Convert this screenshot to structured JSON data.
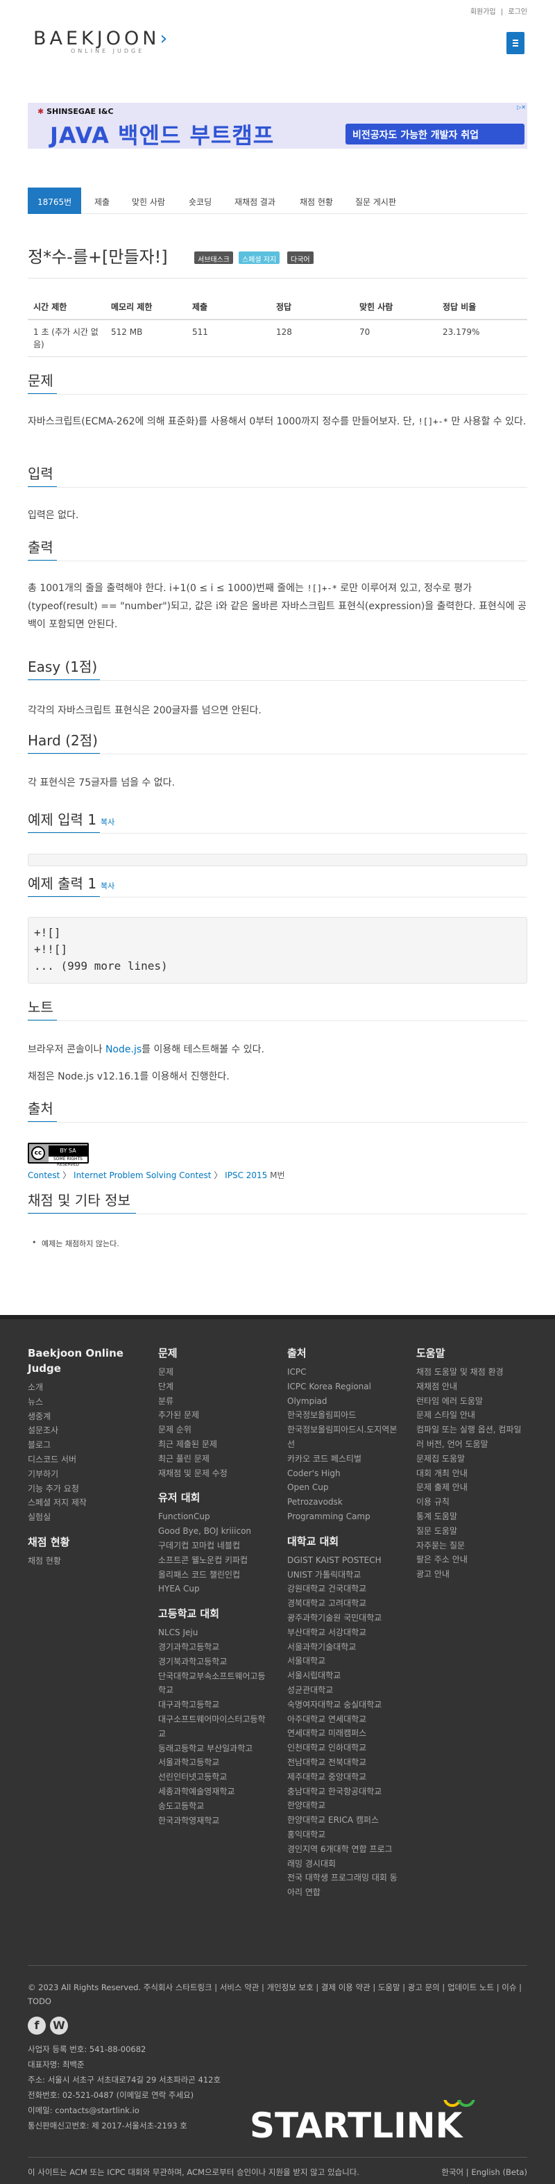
{
  "topbar": {
    "signup": "회원가입",
    "sep": "|",
    "login": "로그인"
  },
  "logo": {
    "text": "BAEKJOON",
    "subtitle": "ONLINE JUDGE"
  },
  "ad": {
    "brand_logo": "SHINSEGAE I&C",
    "headline": "JAVA 백엔드 부트캠프",
    "tagline": "비전공자도 가능한 개발자 취업"
  },
  "tabs": [
    "18765번",
    "제출",
    "맞힌 사람",
    "숏코딩",
    "재채점 결과",
    "채점 현황",
    "질문 게시판"
  ],
  "problem": {
    "title": "정*수-를+[만들자!]",
    "labels": [
      {
        "text": "서브태스크",
        "color": "#555555"
      },
      {
        "text": "스페셜 저지",
        "color": "#5bc0de"
      },
      {
        "text": "다국어",
        "color": "#555555"
      }
    ]
  },
  "table": {
    "headers": [
      "시간 제한",
      "메모리 제한",
      "제출",
      "정답",
      "맞힌 사람",
      "정답 비율"
    ],
    "row": [
      "1 초 (추가 시간 없음)",
      "512 MB",
      "511",
      "128",
      "70",
      "23.179%"
    ]
  },
  "sections": {
    "desc_title": "문제",
    "desc_text_1": "자바스크립트(ECMA-262에 의해 표준화)를 사용해서 0부터 1000까지 정수를 만들어보자. 단, ",
    "desc_code": "![]+-*",
    "desc_text_2": " 만 사용할 수 있다.",
    "input_title": "입력",
    "input_text": "입력은 없다.",
    "output_title": "출력",
    "output_text_1": "총 1001개의 줄을 출력해야 한다. i+1(0 ≤ i ≤ 1000)번째 줄에는 ",
    "output_code": "![]+-*",
    "output_text_2": " 로만 이루어져 있고, 정수로 평가(typeof(result) == \"number\")되고, 값은 i와 같은 올바른 자바스크립트 표현식(expression)을 출력한다. 표현식에 공백이 포함되면 안된다.",
    "easy_title": "Easy (1점)",
    "easy_text": "각각의 자바스크립트 표현식은 200글자를 넘으면 안된다.",
    "hard_title": "Hard (2점)",
    "hard_text": "각 표현식은 75글자를 넘을 수 없다.",
    "sample_in_title": "예제 입력 1",
    "sample_out_title": "예제 출력 1",
    "copy": "복사",
    "sample_out": [
      "+![]",
      "+!![]",
      "... (999 more lines)"
    ],
    "note_title": "노트",
    "note_1a": "브라우저 콘솔이나 ",
    "note_1_link": "Node.js",
    "note_1b": "를 이용해 테스트해볼 수 있다.",
    "note_2": "채점은 Node.js v12.16.1를 이용해서 진행한다.",
    "source_title": "출처",
    "cc_icon_text": "cc",
    "cc_license_text": "BY  SA",
    "cc_footer_text": "SOME RIGHTS RESERVED",
    "crumbs": [
      "Contest",
      "Internet Problem Solving Contest",
      "IPSC 2015",
      "M번"
    ],
    "grading_title": "채점 및 기타 정보",
    "grading_item": "예제는 채점하지 않는다."
  },
  "footer": {
    "col1": {
      "title": "Baekjoon Online Judge",
      "links": [
        "소개",
        "뉴스",
        "생중계",
        "설문조사",
        "블로그",
        "디스코드 서버",
        "기부하기",
        "기능 추가 요청",
        "스페셜 저지 제작",
        "실험실"
      ],
      "title2": "채점 현황",
      "links2": [
        "채점 현황"
      ]
    },
    "col2": {
      "title": "문제",
      "links": [
        "문제",
        "단계",
        "분류",
        "추가된 문제",
        "문제 순위",
        "최근 제출된 문제",
        "최근 풀린 문제",
        "재채점 및 문제 수정"
      ],
      "title2": "유저 대회",
      "links2": [
        "FunctionCup",
        "Good Bye, BOJ kriiicon",
        "구데기컵 꼬마컵 네블컵",
        "소프트콘 웰노운컵 키파컵",
        "올리패스 코드 챌린인컵",
        "HYEA Cup"
      ],
      "title3": "고등학교 대회",
      "links3": [
        "NLCS Jeju",
        "경기과학고등학교",
        "경기북과학고등학교",
        "단국대학교부속소프트웨어고등학교",
        "대구과학고등학교",
        "대구소프트웨어마이스터고등학교",
        "동래고등학교 부산일과학고",
        "서울과학고등학교",
        "선린인터넷고등학교",
        "세종과학예술영재학교",
        "송도고등학교",
        "한국과학영재학교"
      ]
    },
    "col3": {
      "title": "출처",
      "links": [
        "ICPC",
        "ICPC Korea Regional",
        "Olympiad",
        "한국정보올림피아드",
        "한국정보올림피아드시.도지역본선",
        "카카오 코드 페스티벌",
        "Coder's High",
        "Open Cup",
        "Petrozavodsk",
        "Programming Camp"
      ],
      "title2": "대학교 대회",
      "links2": [
        "DGIST KAIST POSTECH",
        "UNIST 가톨릭대학교",
        "강원대학교 건국대학교",
        "경북대학교 고려대학교",
        "광주과학기술원 국민대학교",
        "부산대학교 서강대학교",
        "서울과학기술대학교",
        "서울대학교",
        "서울시립대학교",
        "성균관대학교",
        "숙명여자대학교 숭실대학교",
        "아주대학교 연세대학교",
        "연세대학교 미래캠퍼스",
        "인천대학교 인하대학교",
        "전남대학교 전북대학교",
        "제주대학교 중앙대학교",
        "충남대학교 한국항공대학교",
        "한양대학교",
        "한양대학교 ERICA 캠퍼스",
        "홍익대학교",
        "경인지역 6개대학 연합 프로그래밍 경시대회",
        "전국 대학생 프로그래밍 대회 동아리 연합"
      ]
    },
    "col4": {
      "title": "도움말",
      "links": [
        "채점 도움말 및 채점 환경",
        "재채점 안내",
        "런타임 에러 도움말",
        "문제 스타일 안내",
        "컴파일 또는 실행 옵션, 컴파일러 버전, 언어 도움말",
        "문제집 도움말",
        "대회 개최 안내",
        "문제 출제 안내",
        "이용 규칙",
        "통계 도움말",
        "질문 도움말",
        "자주묻는 질문",
        "팔은 주소 안내",
        "광고 안내"
      ]
    },
    "copyright": "© 2023 All Rights Reserved. 주식회사 스타트링크 | 서비스 약관 | 개인정보 보호 | 결제 이용 약관 | 도움말 | 광고 문의 | 업데이트 노트 | 이슈 | TODO",
    "info": [
      "사업자 등록 번호: 541-88-00682",
      "대표자명: 최백준",
      "주소: 서울시 서초구 서초대로74길 29 서초파라곤 412호",
      "전화번호: 02-521-0487 (이메일로 연락 주세요)",
      "이메일: contacts@startlink.io",
      "통신판매신고번호: 제 2017-서울서초-2193 호"
    ],
    "startlink": "STARTLINK",
    "notice": "이 사이트는 ACM 또는 ICPC 대회와 무관하며, ACM으로부터 승인이나 지원을 받지 않고 있습니다.",
    "lang": "한국어 | English (Beta)"
  }
}
